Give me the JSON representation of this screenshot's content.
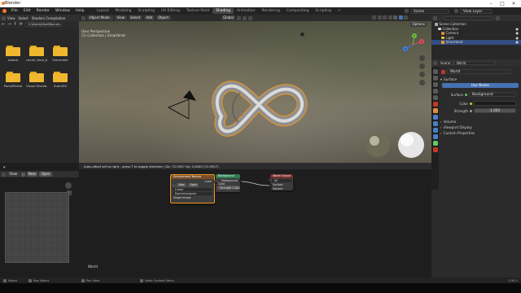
{
  "window": {
    "title": "Blender"
  },
  "menus": [
    "File",
    "Edit",
    "Render",
    "Window",
    "Help"
  ],
  "workspaces": [
    {
      "label": "Layout",
      "active": false
    },
    {
      "label": "Modeling",
      "active": false
    },
    {
      "label": "Sculpting",
      "active": false
    },
    {
      "label": "UV Editing",
      "active": false
    },
    {
      "label": "Texture Paint",
      "active": false
    },
    {
      "label": "Shading",
      "active": true
    },
    {
      "label": "Animation",
      "active": false
    },
    {
      "label": "Rendering",
      "active": false
    },
    {
      "label": "Compositing",
      "active": false
    },
    {
      "label": "Scripting",
      "active": false
    }
  ],
  "topbar_right": {
    "scene": "Scene",
    "view_layer": "View Layer"
  },
  "file_browser": {
    "header_menus": [
      "View",
      "Select"
    ],
    "bookmark_tab": "Shaders Compilation",
    "path": "C:\\Users\\User\\Docum...",
    "folders_row1": [
      "Adobe",
      "cache_fluid_b...",
      "Freemake"
    ],
    "folders_row2": [
      "PortalPortal",
      "Visual Studio...",
      "XuanZhi"
    ]
  },
  "image_editor": {
    "view_label": "View",
    "new_label": "New",
    "open_label": "Open"
  },
  "viewport": {
    "mode": "Object Mode",
    "menus": [
      "View",
      "Select",
      "Add",
      "Object"
    ],
    "transform": "Global",
    "options": "Options",
    "overlay_title": "User Perspective",
    "overlay_sub": "(1) Collection | Smartknot",
    "axes": {
      "x": "X",
      "y": "Y",
      "z": "Z"
    }
  },
  "node_editor": {
    "status_hint": "Auto-offset set to right - press T to toggle direction  |  Dx: 72.0557  Dy: 0.0000 (72.0557)",
    "node_type_label": "World",
    "nodes": {
      "env": {
        "title": "Environment Texture",
        "rows": [
          "Color",
          "Linear",
          "Equirectangular",
          "Single Image",
          "Vector"
        ],
        "btn_new": "New",
        "btn_open": "Open"
      },
      "bg": {
        "title": "Background",
        "rows": [
          "Background",
          "Color",
          "Strength  1.000"
        ]
      },
      "out": {
        "title": "World Output",
        "rows": [
          "All",
          "Surface",
          "Volume"
        ]
      }
    }
  },
  "outliner": {
    "title": "Scene Collection",
    "items": [
      {
        "label": "Scene Collection",
        "selected": false
      },
      {
        "label": "Collection",
        "selected": false
      },
      {
        "label": "Camera",
        "selected": false
      },
      {
        "label": "Light",
        "selected": false
      },
      {
        "label": "Smartknot",
        "selected": true
      }
    ]
  },
  "properties": {
    "scene_label": "Scene",
    "world_label": "World",
    "world_field": "World",
    "surface_section": "Surface",
    "use_nodes": "Use Nodes",
    "surface_label": "Surface",
    "surface_value": "Background",
    "color_label": "Color",
    "strength_label": "Strength",
    "strength_value": "1.000",
    "sections": [
      "Volume",
      "Viewport Display",
      "Custom Properties"
    ]
  },
  "statusbar": {
    "left1": "Select",
    "left2": "Box Select",
    "mid1": "Pan View",
    "mid2": "Node Context Menu",
    "version": "2.90.1"
  },
  "colors": {
    "accent": "#4772b3",
    "selected": "#334d80",
    "object_outline": "#f2961d",
    "folder": "#f0b82e"
  }
}
